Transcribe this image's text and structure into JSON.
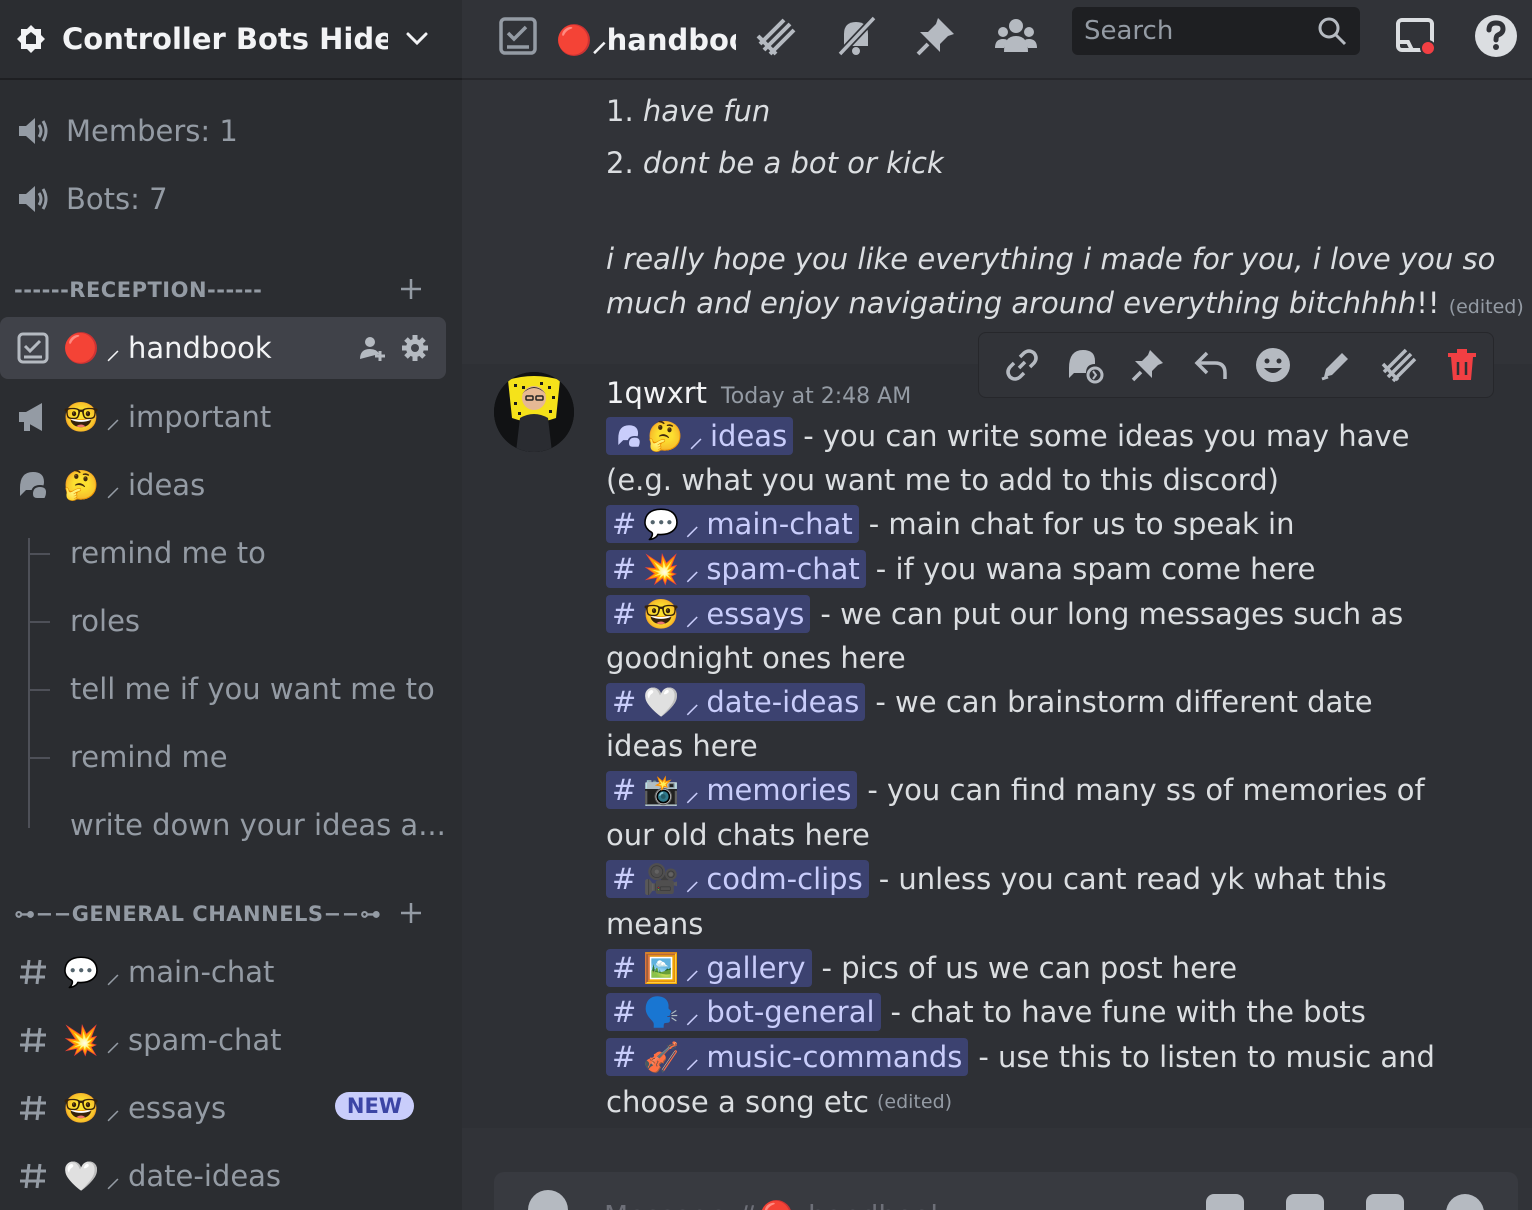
{
  "server": {
    "name": "Controller Bots Hideout",
    "stats": [
      {
        "label": "Members: 1",
        "icon": "speaker-icon"
      },
      {
        "label": "Bots: 7",
        "icon": "speaker-icon"
      }
    ]
  },
  "sidebar": {
    "category_reception": "------RECEPTION------",
    "category_general": "⊶−−GENERAL CHANNELS−−⊶",
    "channels": [
      {
        "emoji": "🔴",
        "name": "handbook",
        "active": true
      },
      {
        "emoji": "🤓",
        "name": "important"
      },
      {
        "emoji": "🤔",
        "name": "ideas"
      }
    ],
    "threads": [
      "remind me to",
      "roles",
      "tell me if you want me to",
      "remind me",
      "write down your ideas a..."
    ],
    "general": [
      {
        "emoji": "💬",
        "name": "main-chat"
      },
      {
        "emoji": "💥",
        "name": "spam-chat"
      },
      {
        "emoji": "🤓",
        "name": "essays",
        "badge": "NEW"
      },
      {
        "emoji": "🤍",
        "name": "date-ideas"
      }
    ],
    "slash": "⸝"
  },
  "topbar": {
    "channel_emoji": "🔴",
    "channel_name": "handbook",
    "search_placeholder": "Search"
  },
  "messages": {
    "rule1_num": "1.",
    "rule1": "have fun",
    "rule2_num": "2.",
    "rule2": "dont be a bot or kick",
    "closing_line1": "i really hope you like everything i made for you, i love you so",
    "closing_line2": "much and enjoy navigating around everything bitchhhh",
    "closing_excl": "!!",
    "edited": "(edited)",
    "author": "1qwxrt",
    "time": "Today at 2:48 AM",
    "channels": [
      {
        "emoji": "🤔",
        "name": "ideas",
        "desc": "- you can write some ideas you may have",
        "desc2": "(e.g. what you want me to add to this discord)",
        "forum": true
      },
      {
        "emoji": "💬",
        "name": "main-chat",
        "desc": "- main chat for us to speak in"
      },
      {
        "emoji": "💥",
        "name": "spam-chat",
        "desc": "- if you wana spam come here"
      },
      {
        "emoji": "🤓",
        "name": "essays",
        "desc": "- we can put our long messages such as",
        "desc2": "goodnight ones here"
      },
      {
        "emoji": "🤍",
        "name": "date-ideas",
        "desc": "- we can brainstorm different date",
        "desc2": "ideas here"
      },
      {
        "emoji": "📸",
        "name": "memories",
        "desc": "- you can find many ss of memories of",
        "desc2": "our old chats here"
      },
      {
        "emoji": "🎥",
        "name": "codm-clips",
        "desc": "- unless you cant read yk what this",
        "desc2": "means"
      },
      {
        "emoji": "🖼️",
        "name": "gallery",
        "desc": "- pics of us we can post here"
      },
      {
        "emoji": "🗣️",
        "name": "bot-general",
        "desc": "- chat to have fune with the bots"
      },
      {
        "emoji": "🎻",
        "name": "music-commands",
        "desc": "- use this to listen to music and",
        "desc2": "choose a song etc"
      }
    ]
  },
  "composer": {
    "placeholder": "Message #🔴⸝handbook"
  },
  "colors": {
    "accent": "#5865f2",
    "mention_bg": "#3c4270",
    "mention_text": "#c9cdfb",
    "delete": "#f23f43"
  }
}
